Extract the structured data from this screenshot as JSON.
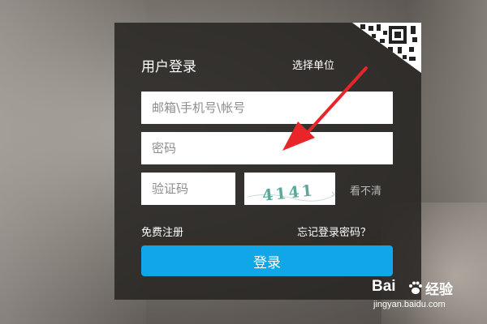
{
  "login": {
    "title": "用户登录",
    "select_unit": "选择单位",
    "username_placeholder": "邮箱\\手机号\\帐号",
    "password_placeholder": "密码",
    "captcha_placeholder": "验证码",
    "captcha_text": "4141",
    "refresh_captcha": "看不清",
    "register": "免费注册",
    "forgot_password": "忘记登录密码？",
    "login_button": "登录"
  },
  "watermark": {
    "logo": "Bai",
    "logo_suffix": "经验",
    "url": "jingyan.baidu.com"
  },
  "colors": {
    "primary_button": "#11a6e8",
    "panel": "#262422",
    "annotation_arrow": "#e8262a"
  },
  "icons": [
    "qr-code-icon",
    "annotation-arrow-icon",
    "baidu-paw-icon"
  ]
}
